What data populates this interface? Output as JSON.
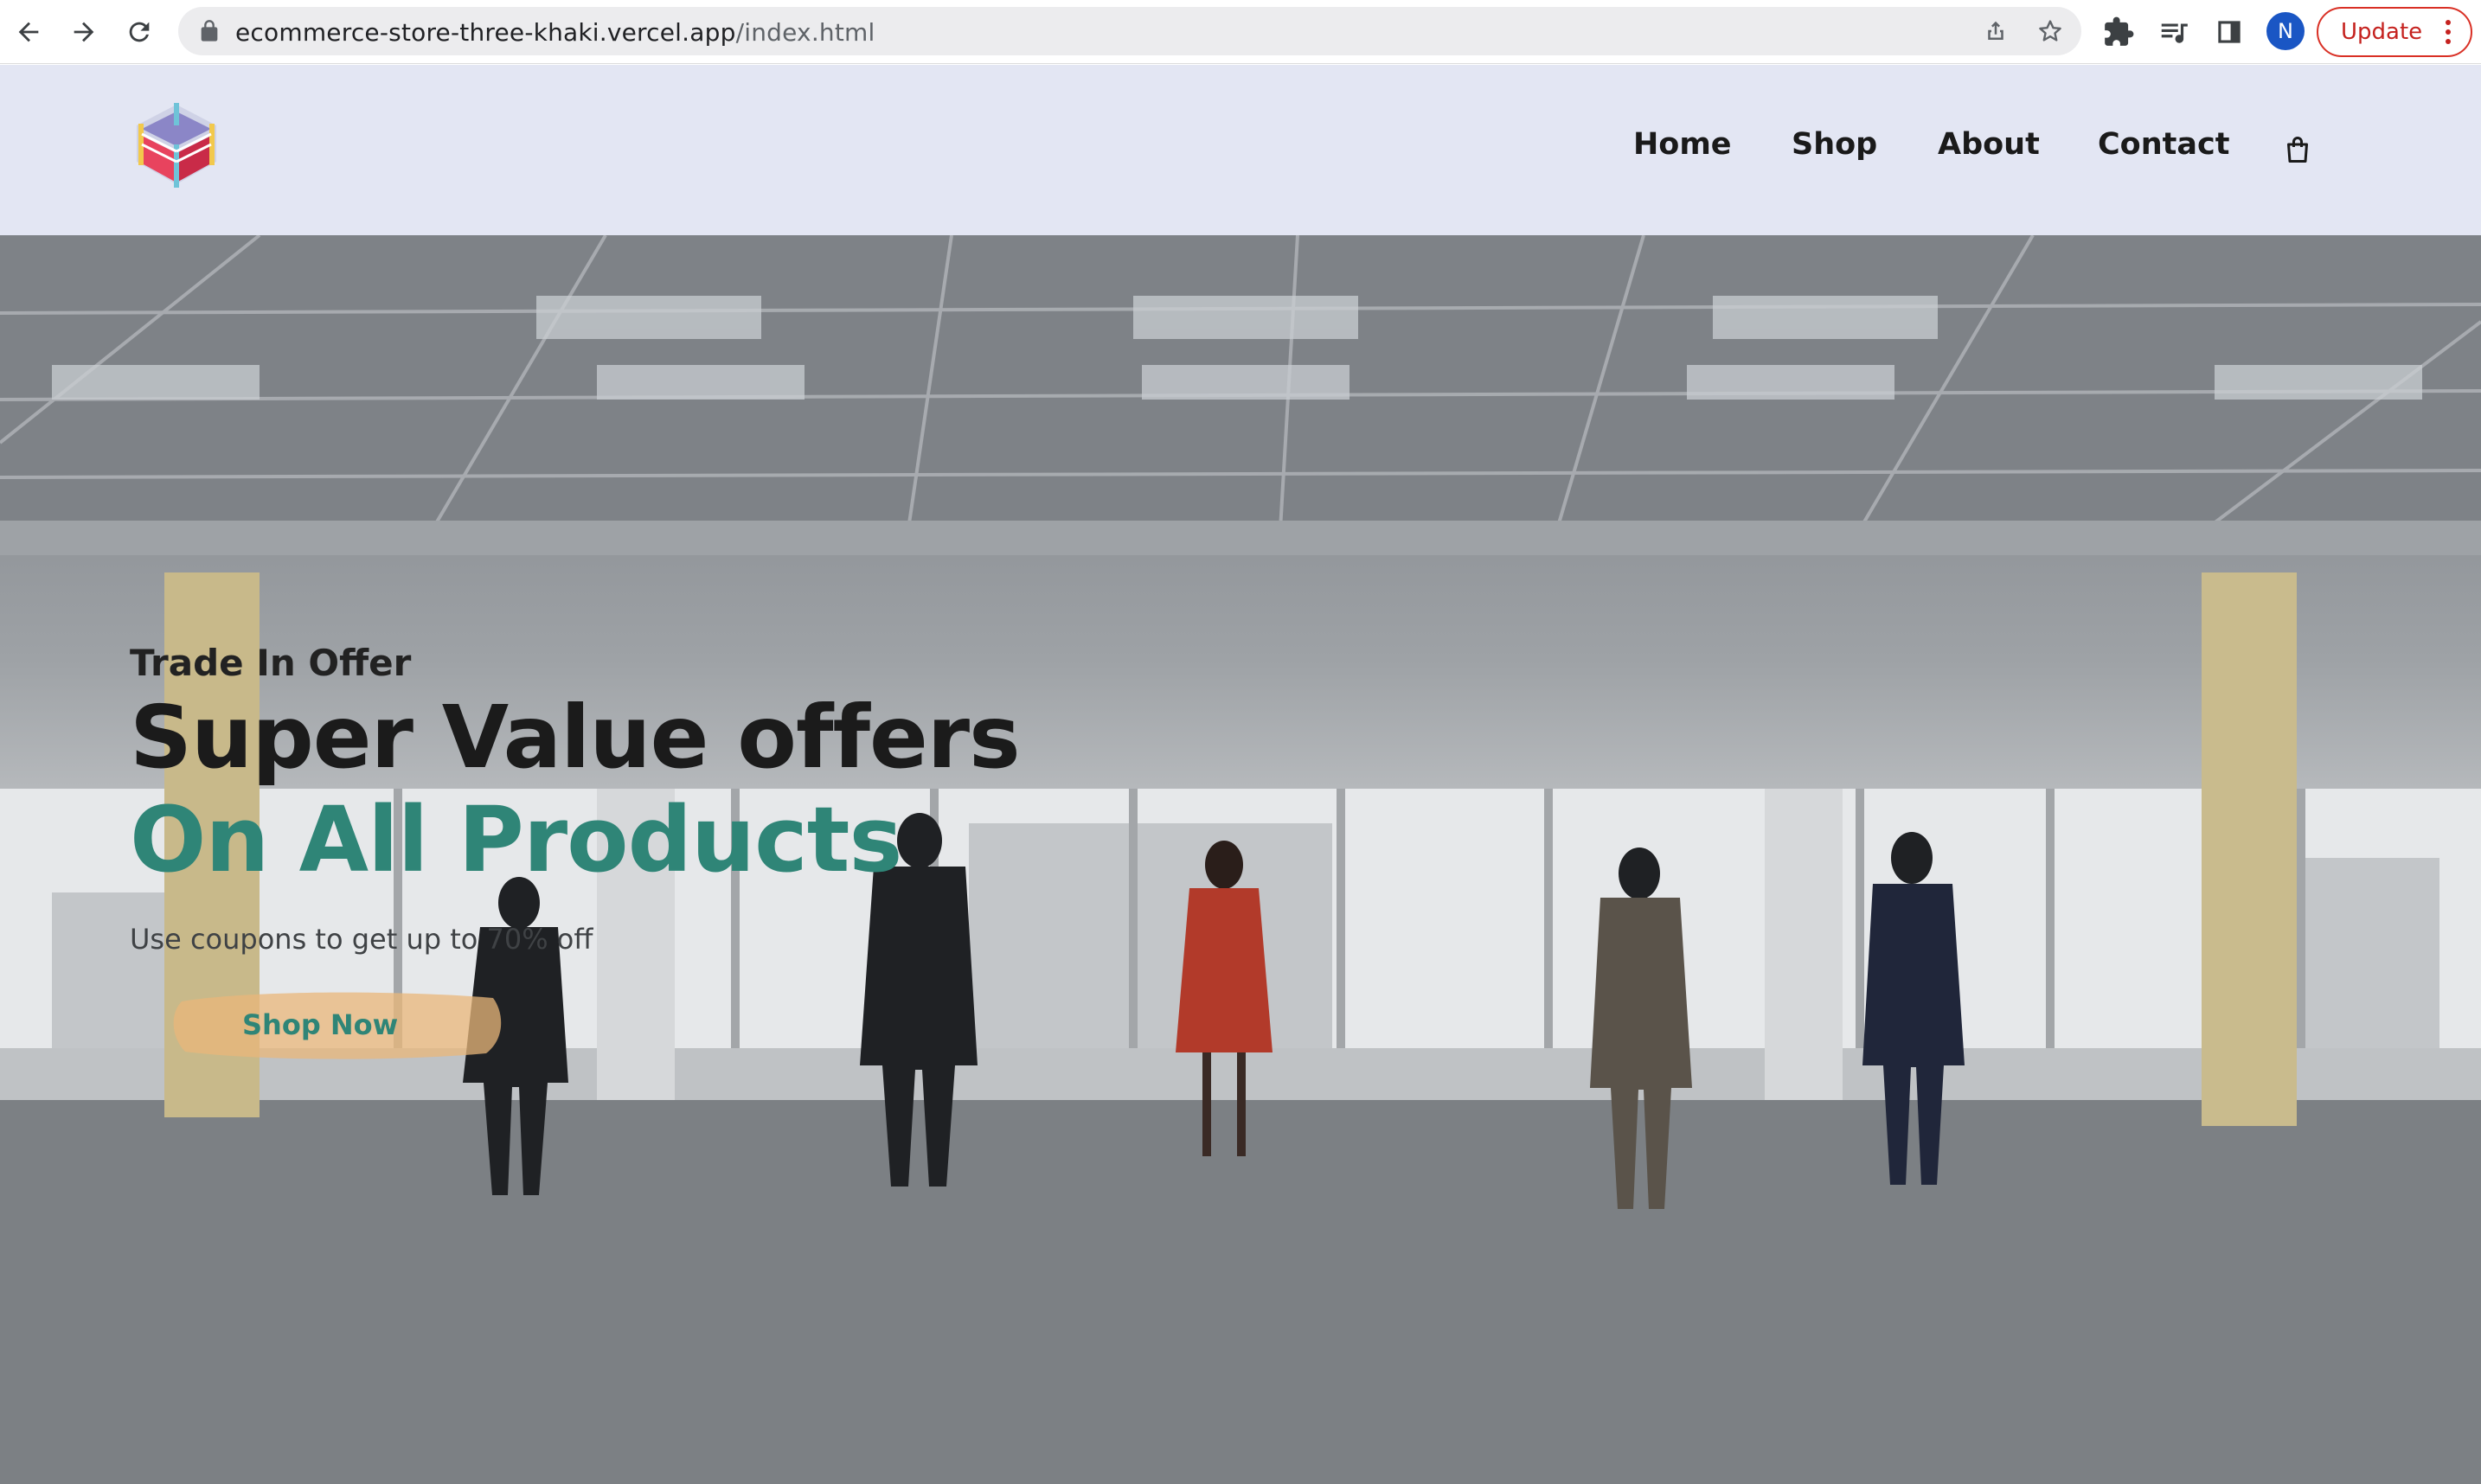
{
  "browser": {
    "url_host": "ecommerce-store-three-khaki.vercel.app",
    "url_path": "/index.html",
    "profile_initial": "N",
    "update_label": "Update",
    "icons": [
      "back-arrow-icon",
      "forward-arrow-icon",
      "reload-icon",
      "lock-icon",
      "share-icon",
      "star-icon",
      "extensions-icon",
      "media-controls-icon",
      "side-panel-icon",
      "more-vert-icon"
    ]
  },
  "site": {
    "nav": [
      {
        "label": "Home"
      },
      {
        "label": "Shop"
      },
      {
        "label": "About"
      },
      {
        "label": "Contact"
      }
    ],
    "cart_icon": "shopping-bag-icon",
    "logo_icon": "boxing-ring-logo"
  },
  "hero": {
    "eyebrow": "Trade In Offer",
    "title": "Super Value offers",
    "title_highlight": "On All Products",
    "subtitle": "Use coupons to get up to 70% off",
    "cta_label": "Shop Now",
    "colors": {
      "highlight": "#2f8577",
      "button": "#e9b77a",
      "header_bg": "#e3e6f3"
    }
  }
}
